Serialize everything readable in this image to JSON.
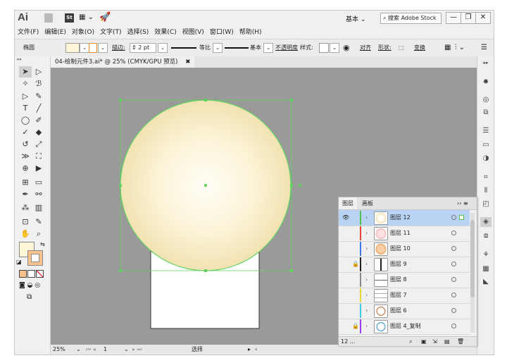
{
  "app": {
    "logo": "Ai",
    "bridge_label": "St",
    "workspace": "基本 ⌄",
    "search_placeholder": "搜索 Adobe Stock",
    "window_buttons": [
      "—",
      "❐",
      "✕"
    ]
  },
  "menu": [
    "文件(F)",
    "编辑(E)",
    "对象(O)",
    "文字(T)",
    "选择(S)",
    "效果(C)",
    "视图(V)",
    "窗口(W)",
    "帮助(H)"
  ],
  "control": {
    "object_label": "椭圆",
    "stroke_label": "描边:",
    "stroke_value": "2 pt",
    "profile1": "等比",
    "profile2": "基本",
    "opacity_label": "不透明度",
    "style_label": "样式:",
    "align_label": "对齐",
    "shape_label": "形状:",
    "transform_label": "变换"
  },
  "document": {
    "tab_title": "04-绘制元件3.ai* @ 25% (CMYK/GPU 预览)",
    "tab_close": "✖"
  },
  "status": {
    "zoom": "25%",
    "page": "1",
    "tool": "选择"
  },
  "layers_panel": {
    "tabs": [
      "图层",
      "画板"
    ],
    "menu_glyph": "›› ≡",
    "footer_count": "12 ...",
    "rows": [
      {
        "name": "图层 12",
        "color": "#4cc24c",
        "selected": true,
        "eye": true,
        "lock": false
      },
      {
        "name": "图层 11",
        "color": "#e8443a",
        "selected": false,
        "eye": false,
        "lock": false
      },
      {
        "name": "图层 10",
        "color": "#3a78e8",
        "selected": false,
        "eye": false,
        "lock": false
      },
      {
        "name": "图层 9",
        "color": "#222222",
        "selected": false,
        "eye": false,
        "lock": true
      },
      {
        "name": "图层 8",
        "color": "#888888",
        "selected": false,
        "eye": false,
        "lock": false
      },
      {
        "name": "图层 7",
        "color": "#e8d43a",
        "selected": false,
        "eye": false,
        "lock": false
      },
      {
        "name": "图层 6",
        "color": "#3ac8e8",
        "selected": false,
        "eye": false,
        "lock": false
      },
      {
        "name": "图层 4_复制",
        "color": "#9a3ae8",
        "selected": false,
        "eye": false,
        "lock": true
      }
    ]
  },
  "colors": {
    "selection_green": "#5fd35f",
    "canvas_gray": "#9b9a9b",
    "circle_center": "#fffdf6",
    "circle_edge": "#f2e2b2"
  }
}
